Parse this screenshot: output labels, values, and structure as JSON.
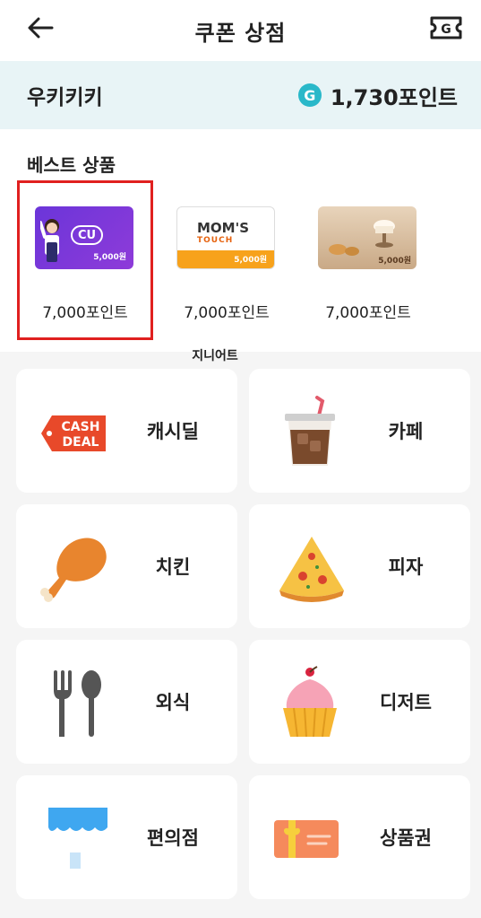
{
  "header": {
    "title": "쿠폰 상점",
    "back_icon": "arrow-left-icon",
    "ticket_icon": "ticket-g-icon"
  },
  "point_bar": {
    "username": "우키키키",
    "coin_label": "G",
    "points": "1,730포인트"
  },
  "best": {
    "title": "베스트 상품",
    "products": [
      {
        "card_text": "CU",
        "amount": "5,000원",
        "price": "7,000포인트"
      },
      {
        "card_text": "MOM'S",
        "card_subtext": "TOUCH",
        "amount": "5,000원",
        "price": "7,000포인트"
      },
      {
        "amount": "5,000원",
        "price": "7,000포인트"
      }
    ],
    "caption": "지니어트"
  },
  "categories": [
    {
      "label": "캐시딜",
      "icon": "cash-deal-icon",
      "badge_top": "CASH",
      "badge_bottom": "DEAL"
    },
    {
      "label": "카페",
      "icon": "iced-coffee-icon"
    },
    {
      "label": "치킨",
      "icon": "chicken-leg-icon"
    },
    {
      "label": "피자",
      "icon": "pizza-slice-icon"
    },
    {
      "label": "외식",
      "icon": "fork-spoon-icon"
    },
    {
      "label": "디저트",
      "icon": "cupcake-icon"
    },
    {
      "label": "편의점",
      "icon": "store-awning-icon"
    },
    {
      "label": "상품권",
      "icon": "gift-card-icon"
    }
  ],
  "colors": {
    "accent": "#29b8c9",
    "selection": "#e0201f",
    "point_bar_bg": "#e8f4f6"
  }
}
